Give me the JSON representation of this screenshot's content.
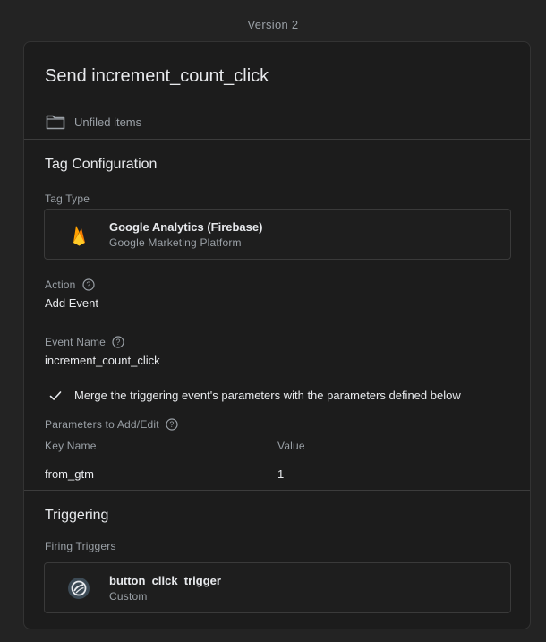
{
  "header": {
    "version": "Version 2"
  },
  "tag": {
    "title": "Send increment_count_click",
    "folder": "Unfiled items"
  },
  "tag_configuration": {
    "section_title": "Tag Configuration",
    "tag_type_label": "Tag Type",
    "tag_type": {
      "name": "Google Analytics (Firebase)",
      "platform": "Google Marketing Platform",
      "icon": "firebase-icon"
    },
    "action_label": "Action",
    "action_value": "Add Event",
    "event_name_label": "Event Name",
    "event_name_value": "increment_count_click",
    "merge_checkbox_label": "Merge the triggering event's parameters with the parameters defined below",
    "merge_checked": true,
    "parameters_label": "Parameters to Add/Edit",
    "parameters_columns": {
      "key": "Key Name",
      "value": "Value"
    },
    "parameters": [
      {
        "key": "from_gtm",
        "value": "1"
      }
    ]
  },
  "triggering": {
    "section_title": "Triggering",
    "firing_triggers_label": "Firing Triggers",
    "trigger": {
      "name": "button_click_trigger",
      "type": "Custom",
      "icon": "custom-trigger-icon"
    }
  },
  "colors": {
    "background": "#232323",
    "card": "#1c1c1c",
    "text_primary": "#e8eaed",
    "text_secondary": "#9aa0a6",
    "firebase_yellow": "#FFCA28",
    "firebase_orange": "#F57C00"
  }
}
